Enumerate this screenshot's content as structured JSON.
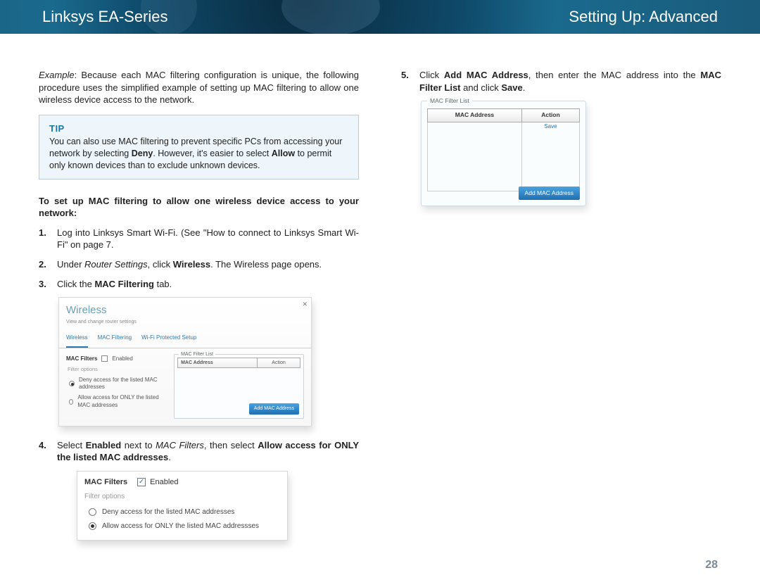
{
  "banner": {
    "left": "Linksys EA-Series",
    "right": "Setting Up: Advanced"
  },
  "left": {
    "example_label": "Example",
    "example_text": ": Because each MAC filtering configuration is unique, the following procedure uses the simplified example of setting up MAC filtering to allow one wireless device access to the network.",
    "tip_title": "TIP",
    "tip_text_a": "You can also use MAC filtering to prevent specific PCs from accessing your network by selecting ",
    "tip_bold1": "Deny",
    "tip_text_b": ". However, it's easier to select ",
    "tip_bold2": "Allow",
    "tip_text_c": " to permit only known devices than to exclude unknown devices.",
    "heading": "To set up MAC filtering to allow one wireless device access to your network:",
    "step1": "Log into Linksys Smart Wi-Fi. (See \"How to connect to Linksys Smart Wi-Fi\" on page 7.",
    "step2_a": "Under ",
    "step2_i": "Router Settings",
    "step2_b": ", click ",
    "step2_bold": "Wireless",
    "step2_c": ". The Wireless page opens.",
    "step3_a": "Click the ",
    "step3_bold": "MAC Filtering",
    "step3_b": " tab.",
    "step4_a": "Select ",
    "step4_bold1": "Enabled",
    "step4_b": " next to ",
    "step4_i": "MAC Filters",
    "step4_c": ", then select ",
    "step4_bold2": "Allow access for ONLY the listed MAC addresses",
    "step4_d": "."
  },
  "shot1": {
    "title": "Wireless",
    "sub": "View and change router settings",
    "tabs": [
      "Wireless",
      "MAC Filtering",
      "Wi-Fi Protected Setup"
    ],
    "mac_filters": "MAC Filters",
    "enabled": "Enabled",
    "filter_options": "Filter options",
    "opt_deny": "Deny access for the listed MAC addresses",
    "opt_allow": "Allow access for ONLY the listed MAC addresses",
    "list_title": "MAC Filter List",
    "col1": "MAC Address",
    "col2": "Action",
    "add_btn": "Add MAC Address"
  },
  "shot2": {
    "mac_filters": "MAC Filters",
    "enabled": "Enabled",
    "filter_options": "Filter options",
    "opt_deny": "Deny access for the listed MAC addresses",
    "opt_allow": "Allow access for ONLY the listed MAC addressses"
  },
  "right": {
    "step5_a": "Click ",
    "step5_bold1": "Add MAC Address",
    "step5_b": ", then enter the MAC address into the ",
    "step5_bold2": "MAC Filter List",
    "step5_c": " and click ",
    "step5_bold3": "Save",
    "step5_d": "."
  },
  "shot3": {
    "list_title": "MAC Filter List",
    "col1": "MAC Address",
    "col2": "Action",
    "save": "Save",
    "add_btn": "Add MAC Address"
  },
  "pagenum": "28"
}
